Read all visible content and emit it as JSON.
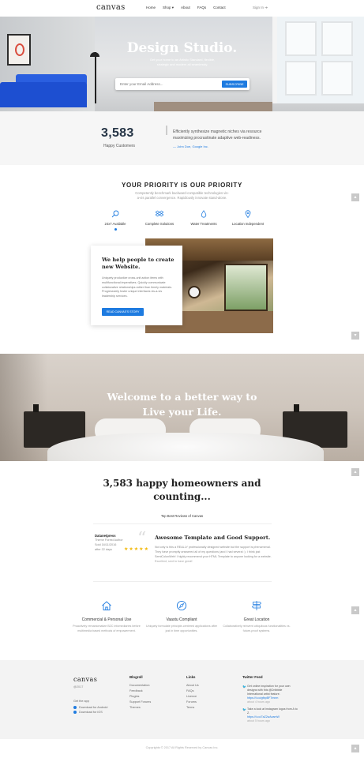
{
  "header": {
    "logo": "canvas",
    "nav": [
      "Home",
      "Shop ▾",
      "About",
      "FAQs",
      "Contact"
    ],
    "signin": "Sign In ➜"
  },
  "hero": {
    "title": "Design Studio.",
    "subtitle": "Get your home to an Artistic Standard, flexible, strategic and modern all seamlessly.",
    "email_placeholder": "Enter your Email Address...",
    "subscribe_label": "SUBSCRIBE"
  },
  "stats": {
    "number": "3,583",
    "label": "Happy Customers",
    "quote": "Efficiently synthesize magnetic niches via resource maximizing procrastinate adaptive web-readiness.",
    "author": "— John Doe, Google Inc."
  },
  "priority": {
    "title": "YOUR PRIORITY IS OUR PRIORITY",
    "subtitle": "Competently benchmark backward-compatible technologies vis-a-vis parallel convergence. Rapidiously innovate stand-alone.",
    "features": [
      {
        "label": "24x7 Available",
        "icon": "search-icon"
      },
      {
        "label": "Complete Solutions",
        "icon": "dropbox-icon"
      },
      {
        "label": "Water Treatments",
        "icon": "droplet-icon"
      },
      {
        "label": "Location Independent",
        "icon": "map-marker-icon"
      }
    ]
  },
  "card": {
    "title": "We help people to create new Website.",
    "text": "Uniquely productize cross-unit action items with multifunctional imperatives. Quickly communicate collaborative relationships rather than timely materials. Progressively foster unique interfaces vis-a-vis leadership services.",
    "button": "READ CANVAS'S STORY"
  },
  "bedroom": {
    "title_line1": "Welcome to a better way to",
    "title_line2": "Live your Life."
  },
  "reviews": {
    "heading": "3,583 happy homeowners and counting...",
    "caption": "Top Best Reviews of Canvas",
    "reviewer": "Datanetpress",
    "role": "Theme Forest Author",
    "date": "Sold 16/11/2016",
    "ago": "after 22 days",
    "stars": 5,
    "title": "Awesome Template and Good Support.",
    "text": "Not only is this a REALLY professionally designed website but the support is phenomenal. They have promptly answered all of my questions (and I had several :). I think just SemiColonWeb! I highly recommend your HTML Template to anyone looking for a website. Excellent, sent to have great!"
  },
  "services": [
    {
      "title": "Commercial & Personal Use",
      "desc": "Proactively remanicmatize B2C infomediaries before multimedia based methods of empowerment.",
      "icon": "home-icon"
    },
    {
      "title": "Vaastu Compliant",
      "desc": "Uniquely formulate principle-centered applications after just in time opportunities.",
      "icon": "compass-icon"
    },
    {
      "title": "Great Location",
      "desc": "Collaboratively reinvent ubiquitous functionalities vs. future-proof systems.",
      "icon": "signpost-icon"
    }
  ],
  "footer": {
    "logo": "canvas",
    "logo_sub": "@2017",
    "get_app": "Get the app",
    "download_android": "Download for Android",
    "download_ios": "Download for iOS",
    "blogroll_title": "Blogroll",
    "blogroll": [
      "Documentation",
      "Feedback",
      "Plugins",
      "Support Forums",
      "Themes"
    ],
    "links_title": "Links",
    "links": [
      "About Us",
      "FAQs",
      "Licence",
      "Forums",
      "Terms"
    ],
    "twitter_title": "Twitter Feed",
    "tweets": [
      {
        "text": "Get online inspiration for your own designs with this @Dribbble International artist feature.",
        "link": "https://t.co/gfbpBFTmnm",
        "time": "about 4 hours ago"
      },
      {
        "text": "Take a look at instagram logos from A to Z.",
        "link": "https://t.co/7aZ2wAvamW",
        "time": "about 5 hours ago"
      }
    ],
    "copyright": "Copyrights © 2017 All Rights Reserved by Canvas Inc."
  },
  "colors": {
    "accent": "#1e7be0",
    "dark": "#222222",
    "star": "#f2b705"
  }
}
